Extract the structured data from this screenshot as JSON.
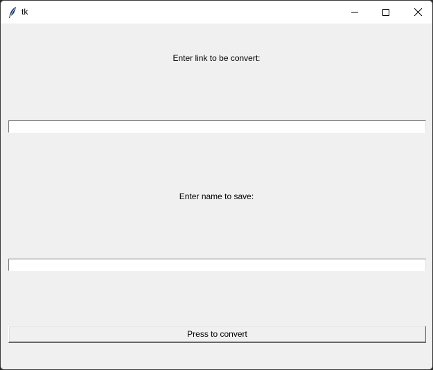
{
  "window": {
    "title": "tk",
    "icon": "feather-icon",
    "controls": {
      "minimize_icon": "minimize-icon",
      "maximize_icon": "maximize-icon",
      "close_icon": "close-icon"
    }
  },
  "form": {
    "link_label": "Enter link to be convert:",
    "link_value": "",
    "name_label": "Enter name to save:",
    "name_value": "",
    "convert_button": "Press to convert"
  },
  "colors": {
    "background": "#f0f0f0",
    "titlebar": "#ffffff",
    "entry_background": "#ffffff"
  }
}
